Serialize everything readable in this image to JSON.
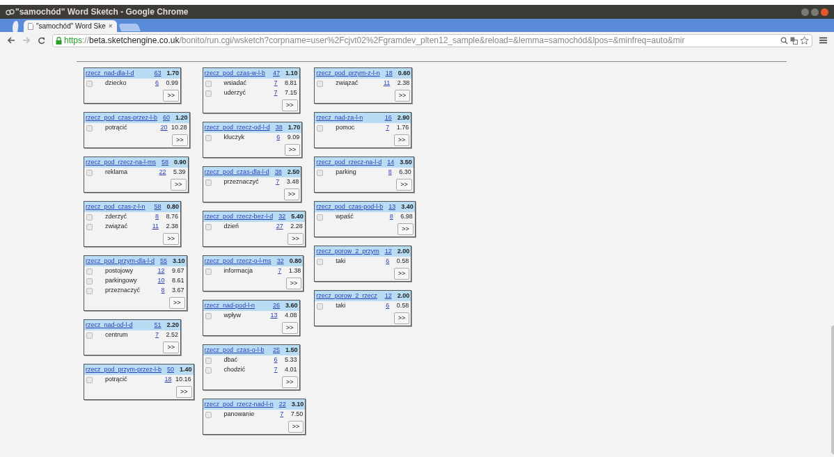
{
  "window": {
    "title": "\"samochód\" Word Sketch - Google Chrome"
  },
  "tabs": [
    {
      "label": "\"samochód\" Word Ske",
      "close": "×",
      "selected": true
    }
  ],
  "address_bar": {
    "scheme": "https",
    "separator": "://",
    "host": "beta.sketchengine.co.uk",
    "path": "/bonito/run.cgi/wsketch?corpname=user%2Fcjvt02%2Fgramdev_plten12_sample&reload=&lemma=samochód&lpos=&minfreq=auto&mir"
  },
  "columns": [
    [
      {
        "relation": "rzecz_nad-dla-l-d",
        "freq": "63",
        "score": "1.70",
        "rows": [
          {
            "word": "dziecko",
            "count": "6",
            "score": "0.99",
            "checked": false
          }
        ],
        "button": ">>"
      },
      {
        "relation": "rzecz_pod_czas-przez-l-b",
        "freq": "60",
        "score": "1.20",
        "rows": [
          {
            "word": "potrącić",
            "count": "20",
            "score": "10.28",
            "checked": false
          }
        ],
        "button": ">>"
      },
      {
        "relation": "rzecz_pod_rzecz-na-l-ms",
        "freq": "58",
        "score": "0.90",
        "rows": [
          {
            "word": "reklama",
            "count": "22",
            "score": "5.39",
            "checked": false
          }
        ],
        "button": ">>"
      },
      {
        "relation": "rzecz_pod_czas-z-l-n",
        "freq": "58",
        "score": "0.80",
        "rows": [
          {
            "word": "zderzyć",
            "count": "8",
            "score": "8.76",
            "checked": false
          },
          {
            "word": "związać",
            "count": "11",
            "score": "2.38",
            "checked": false
          }
        ],
        "button": ">>"
      },
      {
        "relation": "rzecz_pod_przym-dla-l-d",
        "freq": "55",
        "score": "3.10",
        "rows": [
          {
            "word": "postojowy",
            "count": "12",
            "score": "9.67",
            "checked": false
          },
          {
            "word": "parkingowy",
            "count": "10",
            "score": "8.61",
            "checked": false
          },
          {
            "word": "przeznaczyć",
            "count": "8",
            "score": "3.67",
            "checked": false
          }
        ],
        "button": ">>"
      },
      {
        "relation": "rzecz_nad-od-l-d",
        "freq": "51",
        "score": "2.20",
        "rows": [
          {
            "word": "centrum",
            "count": "7",
            "score": "2.52",
            "checked": false
          }
        ],
        "button": ">>"
      },
      {
        "relation": "rzecz_pod_przym-przez-l-b",
        "freq": "50",
        "score": "1.40",
        "rows": [
          {
            "word": "potrącić",
            "count": "18",
            "score": "10.16",
            "checked": false
          }
        ],
        "button": ">>"
      }
    ],
    [
      {
        "relation": "rzecz_pod_czas-w-l-b",
        "freq": "47",
        "score": "1.10",
        "rows": [
          {
            "word": "wsiadać",
            "count": "7",
            "score": "8.81",
            "checked": false
          },
          {
            "word": "uderzyć",
            "count": "7",
            "score": "7.15",
            "checked": false
          }
        ],
        "button": ">>"
      },
      {
        "relation": "rzecz_pod_rzecz-od-l-d",
        "freq": "38",
        "score": "1.70",
        "rows": [
          {
            "word": "kluczyk",
            "count": "6",
            "score": "9.09",
            "checked": false
          }
        ],
        "button": ">>"
      },
      {
        "relation": "rzecz_pod_czas-dla-l-d",
        "freq": "38",
        "score": "2.50",
        "rows": [
          {
            "word": "przeznaczyć",
            "count": "7",
            "score": "3.48",
            "checked": false
          }
        ],
        "button": ">>"
      },
      {
        "relation": "rzecz_pod_rzecz-bez-l-d",
        "freq": "32",
        "score": "5.40",
        "rows": [
          {
            "word": "dzień",
            "count": "27",
            "score": "2.28",
            "checked": false
          }
        ],
        "button": ">>"
      },
      {
        "relation": "rzecz_pod_rzecz-o-l-ms",
        "freq": "32",
        "score": "0.80",
        "rows": [
          {
            "word": "informacja",
            "count": "7",
            "score": "1.38",
            "checked": false
          }
        ],
        "button": ">>"
      },
      {
        "relation": "rzecz_nad-pod-l-n",
        "freq": "26",
        "score": "3.60",
        "rows": [
          {
            "word": "wpływ",
            "count": "13",
            "score": "4.08",
            "checked": false
          }
        ],
        "button": ">>"
      },
      {
        "relation": "rzecz_pod_czas-o-l-b",
        "freq": "25",
        "score": "1.50",
        "rows": [
          {
            "word": "dbać",
            "count": "6",
            "score": "5.33",
            "checked": false
          },
          {
            "word": "chodzić",
            "count": "7",
            "score": "4.01",
            "checked": false
          }
        ],
        "button": ">>"
      },
      {
        "relation": "rzecz_pod_rzecz-nad-l-n",
        "freq": "22",
        "score": "3.10",
        "rows": [
          {
            "word": "panowanie",
            "count": "7",
            "score": "7.50",
            "checked": false
          }
        ],
        "button": ">>"
      }
    ],
    [
      {
        "relation": "rzecz_pod_przym-z-l-n",
        "freq": "18",
        "score": "0.60",
        "rows": [
          {
            "word": "związać",
            "count": "11",
            "score": "2.38",
            "checked": false
          }
        ],
        "button": ">>"
      },
      {
        "relation": "rzecz_nad-za-l-n",
        "freq": "16",
        "score": "2.90",
        "rows": [
          {
            "word": "pomoc",
            "count": "7",
            "score": "1.76",
            "checked": false
          }
        ],
        "button": ">>"
      },
      {
        "relation": "rzecz_pod_rzecz-na-l-d",
        "freq": "14",
        "score": "3.50",
        "rows": [
          {
            "word": "parking",
            "count": "8",
            "score": "6.30",
            "checked": false
          }
        ],
        "button": ">>"
      },
      {
        "relation": "rzecz_pod_czas-pod-l-b",
        "freq": "13",
        "score": "3.40",
        "rows": [
          {
            "word": "wpaść",
            "count": "8",
            "score": "6.98",
            "checked": false
          }
        ],
        "button": ">>"
      },
      {
        "relation": "rzecz_porow_2_przym",
        "freq": "12",
        "score": "2.00",
        "rows": [
          {
            "word": "taki",
            "count": "6",
            "score": "0.58",
            "checked": false
          }
        ],
        "button": ">>"
      },
      {
        "relation": "rzecz_porow_2_rzecz",
        "freq": "12",
        "score": "2.00",
        "rows": [
          {
            "word": "taki",
            "count": "6",
            "score": "0.58",
            "checked": false
          }
        ],
        "button": ">>"
      }
    ]
  ]
}
